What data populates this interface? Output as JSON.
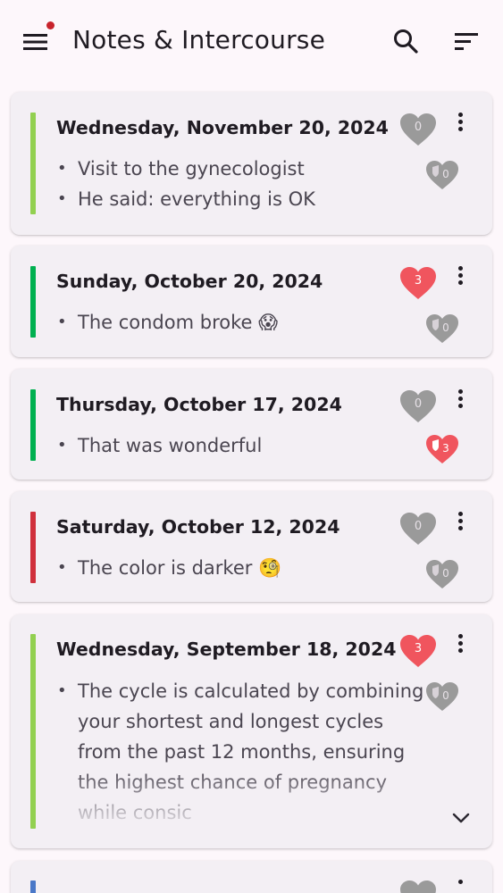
{
  "app": {
    "title": "Notes & Intercourse",
    "icons": {
      "menu": "menu-icon",
      "search": "search-icon",
      "sort": "sort-icon"
    },
    "badge_color": "#c8232c"
  },
  "colors": {
    "background": "#fdf7fb",
    "card": "#f3eff4",
    "heart_red": "#f0555e",
    "heart_grey": "#9a9a9a"
  },
  "notes": [
    {
      "date": "Wednesday, November 20, 2024",
      "bar_color": "#92d050",
      "items": [
        "Visit to the gynecologist",
        "He said: everything is OK"
      ],
      "sex_count": "0",
      "sex_active": false,
      "protected_count": "0",
      "protected_active": false
    },
    {
      "date": "Sunday, October 20, 2024",
      "bar_color": "#00b050",
      "items": [
        "The condom broke 😱"
      ],
      "sex_count": "3",
      "sex_active": true,
      "protected_count": "0",
      "protected_active": false
    },
    {
      "date": "Thursday, October 17, 2024",
      "bar_color": "#00b050",
      "items": [
        "That was wonderful"
      ],
      "sex_count": "0",
      "sex_active": false,
      "protected_count": "3",
      "protected_active": true
    },
    {
      "date": "Saturday, October 12, 2024",
      "bar_color": "#d0303c",
      "items": [
        "The color is darker 🧐"
      ],
      "sex_count": "0",
      "sex_active": false,
      "protected_count": "0",
      "protected_active": false
    },
    {
      "date": "Wednesday, September 18, 2024",
      "bar_color": "#92d050",
      "items": [
        "The cycle is calculated by combining your shortest and longest cycles from the past 12 months, ensuring the highest chance of pregnancy while consic"
      ],
      "sex_count": "3",
      "sex_active": true,
      "protected_count": "0",
      "protected_active": false
    }
  ]
}
